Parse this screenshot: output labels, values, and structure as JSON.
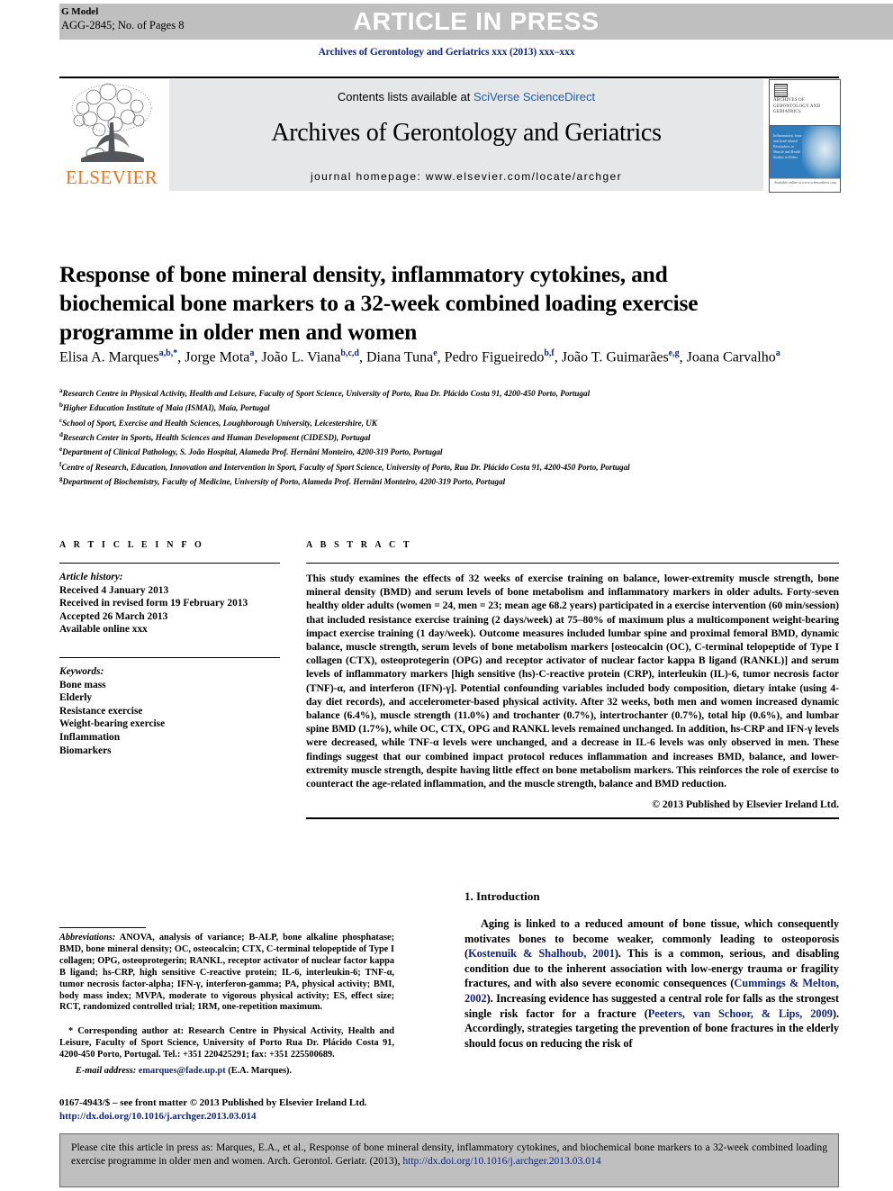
{
  "banner": {
    "article_in_press": "ARTICLE IN PRESS",
    "gmodel_label": "G Model",
    "gmodel_id": "AGG-2845; No. of Pages 8"
  },
  "journal_ref": "Archives of Gerontology and Geriatrics xxx (2013) xxx–xxx",
  "masthead": {
    "contents_prefix": "Contents lists available at",
    "contents_link": "SciVerse ScienceDirect",
    "journal_name": "Archives of Gerontology and Geriatrics",
    "homepage": "journal homepage: www.elsevier.com/locate/archger",
    "publisher": "ELSEVIER",
    "cover_title": "ARCHIVES OF GERONTOLOGY AND GERIATRICS",
    "cover_blurb": "Inflammation, bone and bone-related Biomarkers in Muscle and Health Studies in Elders",
    "cover_foot": "Available online at www.sciencedirect.com"
  },
  "article": {
    "title": "Response of bone mineral density, inflammatory cytokines, and biochemical bone markers to a 32-week combined loading exercise programme in older men and women",
    "authors": [
      {
        "name": "Elisa A. Marques",
        "sup": "a,b,*"
      },
      {
        "name": "Jorge Mota",
        "sup": "a"
      },
      {
        "name": "João L. Viana",
        "sup": "b,c,d"
      },
      {
        "name": "Diana Tuna",
        "sup": "e"
      },
      {
        "name": "Pedro Figueiredo",
        "sup": "b,f"
      },
      {
        "name": "João T. Guimarães",
        "sup": "e,g"
      },
      {
        "name": "Joana Carvalho",
        "sup": "a"
      }
    ],
    "affiliations": [
      {
        "mark": "a",
        "text": "Research Centre in Physical Activity, Health and Leisure, Faculty of Sport Science, University of Porto, Rua Dr. Plácido Costa 91, 4200-450 Porto, Portugal"
      },
      {
        "mark": "b",
        "text": "Higher Education Institute of Maia (ISMAI), Maia, Portugal"
      },
      {
        "mark": "c",
        "text": "School of Sport, Exercise and Health Sciences, Loughborough University, Leicestershire, UK"
      },
      {
        "mark": "d",
        "text": "Research Center in Sports, Health Sciences and Human Development (CIDESD), Portugal"
      },
      {
        "mark": "e",
        "text": "Department of Clinical Pathology, S. João Hospital, Alameda Prof. Hernâni Monteiro, 4200-319 Porto, Portugal"
      },
      {
        "mark": "f",
        "text": "Centre of Research, Education, Innovation and Intervention in Sport, Faculty of Sport Science, University of Porto, Rua Dr. Plácido Costa 91, 4200-450 Porto, Portugal"
      },
      {
        "mark": "g",
        "text": "Department of Biochemistry, Faculty of Medicine, University of Porto, Alameda Prof. Hernâni Monteiro, 4200-319 Porto, Portugal"
      }
    ]
  },
  "article_info": {
    "heading": "A R T I C L E   I N F O",
    "history_label": "Article history:",
    "history": [
      "Received 4 January 2013",
      "Received in revised form 19 February 2013",
      "Accepted 26 March 2013",
      "Available online xxx"
    ],
    "keywords_label": "Keywords:",
    "keywords": [
      "Bone mass",
      "Elderly",
      "Resistance exercise",
      "Weight-bearing exercise",
      "Inflammation",
      "Biomarkers"
    ]
  },
  "abstract": {
    "heading": "A B S T R A C T",
    "text": "This study examines the effects of 32 weeks of exercise training on balance, lower-extremity muscle strength, bone mineral density (BMD) and serum levels of bone metabolism and inflammatory markers in older adults. Forty-seven healthy older adults (women = 24, men = 23; mean age 68.2 years) participated in a exercise intervention (60 min/session) that included resistance exercise training (2 days/week) at 75–80% of maximum plus a multicomponent weight-bearing impact exercise training (1 day/week). Outcome measures included lumbar spine and proximal femoral BMD, dynamic balance, muscle strength, serum levels of bone metabolism markers [osteocalcin (OC), C-terminal telopeptide of Type I collagen (CTX), osteoprotegerin (OPG) and receptor activator of nuclear factor kappa B ligand (RANKL)] and serum levels of inflammatory markers [high sensitive (hs)-C-reactive protein (CRP), interleukin (IL)-6, tumor necrosis factor (TNF)-α, and interferon (IFN)-γ]. Potential confounding variables included body composition, dietary intake (using 4-day diet records), and accelerometer-based physical activity. After 32 weeks, both men and women increased dynamic balance (6.4%), muscle strength (11.0%) and trochanter (0.7%), intertrochanter (0.7%), total hip (0.6%), and lumbar spine BMD (1.7%), while OC, CTX, OPG and RANKL levels remained unchanged. In addition, hs-CRP and IFN-γ levels were decreased, while TNF-α levels were unchanged, and a decrease in IL-6 levels was only observed in men. These findings suggest that our combined impact protocol reduces inflammation and increases BMD, balance, and lower-extremity muscle strength, despite having little effect on bone metabolism markers. This reinforces the role of exercise to counteract the age-related inflammation, and the muscle strength, balance and BMD reduction.",
    "copyright": "© 2013 Published by Elsevier Ireland Ltd."
  },
  "footnotes": {
    "abbrev_label": "Abbreviations:",
    "abbrev_text": " ANOVA, analysis of variance; B-ALP, bone alkaline phosphatase; BMD, bone mineral density; OC, osteocalcin; CTX, C-terminal telopeptide of Type I collagen; OPG, osteoprotegerin; RANKL, receptor activator of nuclear factor kappa B ligand; hs-CRP, high sensitive C-reactive protein; IL-6, interleukin-6; TNF-α, tumor necrosis factor-alpha; IFN-γ, interferon-gamma; PA, physical activity; BMI, body mass index; MVPA, moderate to vigorous physical activity; ES, effect size; RCT, randomized controlled trial; 1RM, one-repetition maximum.",
    "corresponding": "* Corresponding author at: Research Centre in Physical Activity, Health and Leisure, Faculty of Sport Science, University of Porto Rua Dr. Plácido Costa 91, 4200-450 Porto, Portugal. Tel.: +351 220425291; fax: +351 225500689.",
    "email_label": "E-mail address:",
    "email": "emarques@fade.up.pt",
    "email_owner": "(E.A. Marques)."
  },
  "introduction": {
    "heading": "1. Introduction",
    "paragraph_parts": [
      {
        "t": "Aging is linked to a reduced amount of bone tissue, which consequently motivates bones to become weaker, commonly leading to osteoporosis (",
        "cite": false
      },
      {
        "t": "Kostenuik & Shalhoub, 2001",
        "cite": true
      },
      {
        "t": "). This is a common, serious, and disabling condition due to the inherent association with low-energy trauma or fragility fractures, and with also severe economic consequences (",
        "cite": false
      },
      {
        "t": "Cummings & Melton, 2002",
        "cite": true
      },
      {
        "t": "). Increasing evidence has suggested a central role for falls as the strongest single risk factor for a fracture (",
        "cite": false
      },
      {
        "t": "Peeters, van Schoor, & Lips, 2009",
        "cite": true
      },
      {
        "t": "). Accordingly, strategies targeting the prevention of bone fractures in the elderly should focus on reducing the risk of",
        "cite": false
      }
    ]
  },
  "bottom": {
    "issn_line": "0167-4943/$ – see front matter © 2013 Published by Elsevier Ireland Ltd.",
    "doi_link": "http://dx.doi.org/10.1016/j.archger.2013.03.014",
    "citation_prefix": "Please cite this article in press as: Marques, E.A., et al., Response of bone mineral density, inflammatory cytokines, and biochemical bone markers to a 32-week combined loading exercise programme in older men and women. Arch. Gerontol. Geriatr. (2013), ",
    "citation_link": "http://dx.doi.org/10.1016/j.archger.2013.03.014"
  },
  "colors": {
    "link": "#13267a",
    "banner_bg": "#bfbfbf",
    "masthead_bg": "#e6e7e8",
    "elsevier_orange": "#e87722"
  }
}
